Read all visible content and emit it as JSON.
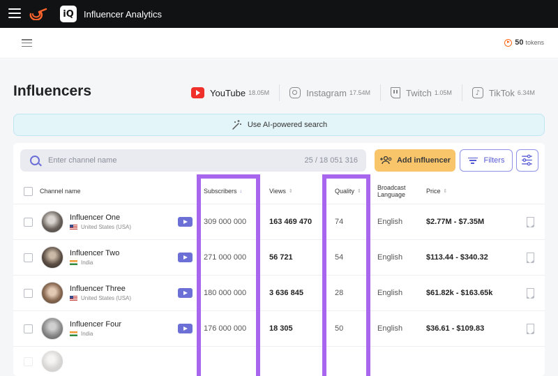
{
  "app": {
    "title": "Influencer Analytics",
    "logo_text": "iQ"
  },
  "tokens": {
    "count": "50",
    "unit": "tokens"
  },
  "page": {
    "title": "Influencers"
  },
  "platforms": [
    {
      "name": "YouTube",
      "count": "18.05M",
      "icon": "youtube-icon",
      "active": true
    },
    {
      "name": "Instagram",
      "count": "17.54M",
      "icon": "instagram-icon",
      "active": false
    },
    {
      "name": "Twitch",
      "count": "1.05M",
      "icon": "twitch-icon",
      "active": false
    },
    {
      "name": "TikTok",
      "count": "6.34M",
      "icon": "tiktok-icon",
      "active": false
    }
  ],
  "ai_search": {
    "label": "Use AI-powered search"
  },
  "search": {
    "placeholder": "Enter channel name",
    "count": "25 / 18 051 316"
  },
  "buttons": {
    "add_influencer": "Add influencer",
    "filters": "Filters"
  },
  "table": {
    "headers": {
      "channel_name": "Channel name",
      "subscribers": "Subscribers",
      "views": "Views",
      "quality": "Quality",
      "broadcast_language_1": "Broadcast",
      "broadcast_language_2": "Language",
      "price": "Price"
    },
    "rows": [
      {
        "name": "Influencer One",
        "country": "United States (USA)",
        "flag": "us",
        "subscribers": "309 000 000",
        "views": "163 469 470",
        "quality": "74",
        "language": "English",
        "price": "$2.77M - $7.35M"
      },
      {
        "name": "Influencer Two",
        "country": "India",
        "flag": "in",
        "subscribers": "271 000 000",
        "views": "56 721",
        "quality": "54",
        "language": "English",
        "price": "$113.44 - $340.32"
      },
      {
        "name": "Influencer Three",
        "country": "United States (USA)",
        "flag": "us",
        "subscribers": "180 000 000",
        "views": "3 636 845",
        "quality": "28",
        "language": "English",
        "price": "$61.82k - $163.65k"
      },
      {
        "name": "Influencer Four",
        "country": "India",
        "flag": "in",
        "subscribers": "176 000 000",
        "views": "18 305",
        "quality": "50",
        "language": "English",
        "price": "$36.61 - $109.83"
      }
    ]
  },
  "colors": {
    "highlight": "#a866ee",
    "accent": "#6b6fd6",
    "add_button": "#f8c56a",
    "topbar": "#111214"
  }
}
